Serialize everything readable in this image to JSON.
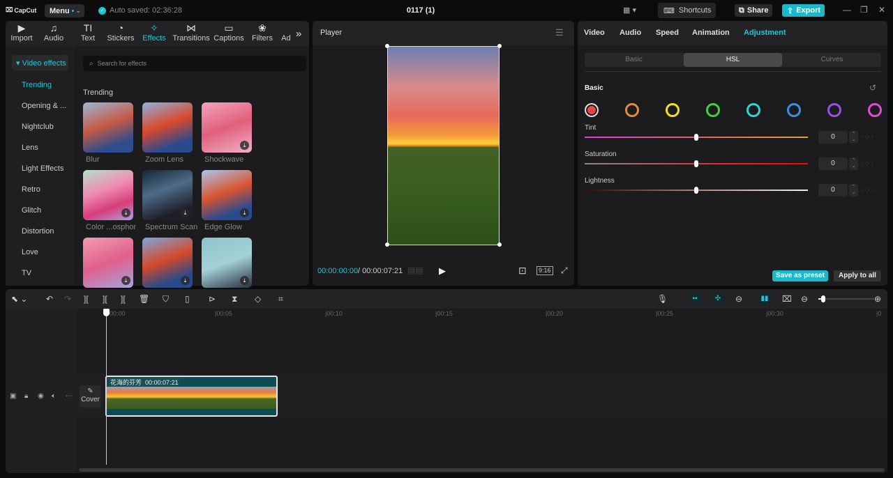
{
  "titlebar": {
    "logo": "CapCut",
    "menu_label": "Menu",
    "autosave": "Auto saved: 02:36:28",
    "project_title": "0117 (1)",
    "shortcuts": "Shortcuts",
    "share": "Share",
    "export": "Export"
  },
  "media_tabs": [
    {
      "label": "Import",
      "icon": "▶"
    },
    {
      "label": "Audio",
      "icon": "♫"
    },
    {
      "label": "Text",
      "icon": "TI"
    },
    {
      "label": "Stickers",
      "icon": "◔"
    },
    {
      "label": "Effects",
      "icon": "✧"
    },
    {
      "label": "Transitions",
      "icon": "⋈"
    },
    {
      "label": "Captions",
      "icon": "▭"
    },
    {
      "label": "Filters",
      "icon": "❀"
    },
    {
      "label": "Ad",
      "icon": ""
    }
  ],
  "effects": {
    "category_header": "▾ Video effects",
    "categories": [
      "Trending",
      "Opening & ...",
      "Nightclub",
      "Lens",
      "Light Effects",
      "Retro",
      "Glitch",
      "Distortion",
      "Love",
      "TV"
    ],
    "search_placeholder": "Search for effects",
    "section_title": "Trending",
    "items": [
      {
        "label": "Blur",
        "bg": "linear-gradient(160deg,#9db6d8,#c55a46 45%,#2d4d8c 80%)",
        "download": false
      },
      {
        "label": "Zoom Lens",
        "bg": "linear-gradient(160deg,#8fb1de,#d8492d 45%,#2a4a8e 80%)",
        "download": false
      },
      {
        "label": "Shockwave",
        "bg": "linear-gradient(160deg,#f3a3c0,#e0607a 50%,#f1b0c8)",
        "download": true
      },
      {
        "label": "Color ...osphor",
        "bg": "linear-gradient(160deg,#b7e0c9,#f08bb2 40%,#d53f7a 70%,#ae9fe3)",
        "download": true
      },
      {
        "label": "Spectrum Scan",
        "bg": "linear-gradient(160deg,#162635,#4e6c87 40%,#1e1e2a 80%)",
        "download": true
      },
      {
        "label": "Edge Glow",
        "bg": "linear-gradient(160deg,#a8c7ee,#d9552f 45%,#2a4a8e 80%)",
        "download": true
      },
      {
        "label": "",
        "bg": "linear-gradient(160deg,#f29bb0,#e0608a 50%,#a7a2e0)",
        "download": true
      },
      {
        "label": "",
        "bg": "linear-gradient(160deg,#7fa6de,#d34a2a 45%,#274a8a 80%)",
        "download": true
      },
      {
        "label": "",
        "bg": "linear-gradient(160deg,#8ec4cc,#a3d1d6 50%,#2a3040)",
        "download": true
      }
    ]
  },
  "player": {
    "title": "Player",
    "current_time": "00:00:00:00",
    "total_time": "/ 00:00:07:21",
    "aspect_ratio": "9:16"
  },
  "inspector": {
    "tabs": [
      "Video",
      "Audio",
      "Speed",
      "Animation",
      "Adjustment"
    ],
    "active_tab": "Adjustment",
    "subtabs": [
      "Basic",
      "HSL",
      "Curves"
    ],
    "active_subtab": "HSL",
    "section_title": "Basic",
    "swatches": [
      "#e84545",
      "#e58a3c",
      "#f0e31a",
      "#3bd43b",
      "#2fd4d4",
      "#3d8fe0",
      "#9c4fe6",
      "#e449d6"
    ],
    "selected_swatch": 0,
    "sliders": [
      {
        "label": "Tint",
        "value": "0",
        "position": 0.5
      },
      {
        "label": "Saturation",
        "value": "0",
        "position": 0.5
      },
      {
        "label": "Lightness",
        "value": "0",
        "position": 0.5
      }
    ],
    "save_preset": "Save as preset",
    "apply_all": "Apply to all"
  },
  "timeline": {
    "ruler_ticks": [
      "00:00",
      "|00:05",
      "|00:10",
      "|00:15",
      "|00:20",
      "|00:25",
      "|00:30",
      "|0"
    ],
    "clip": {
      "name": "花海的芬芳",
      "duration": "00:00:07:21"
    },
    "cover_label": "Cover",
    "zoom_level": 0.1
  },
  "colors": {
    "accent": "#1ec4d4"
  }
}
